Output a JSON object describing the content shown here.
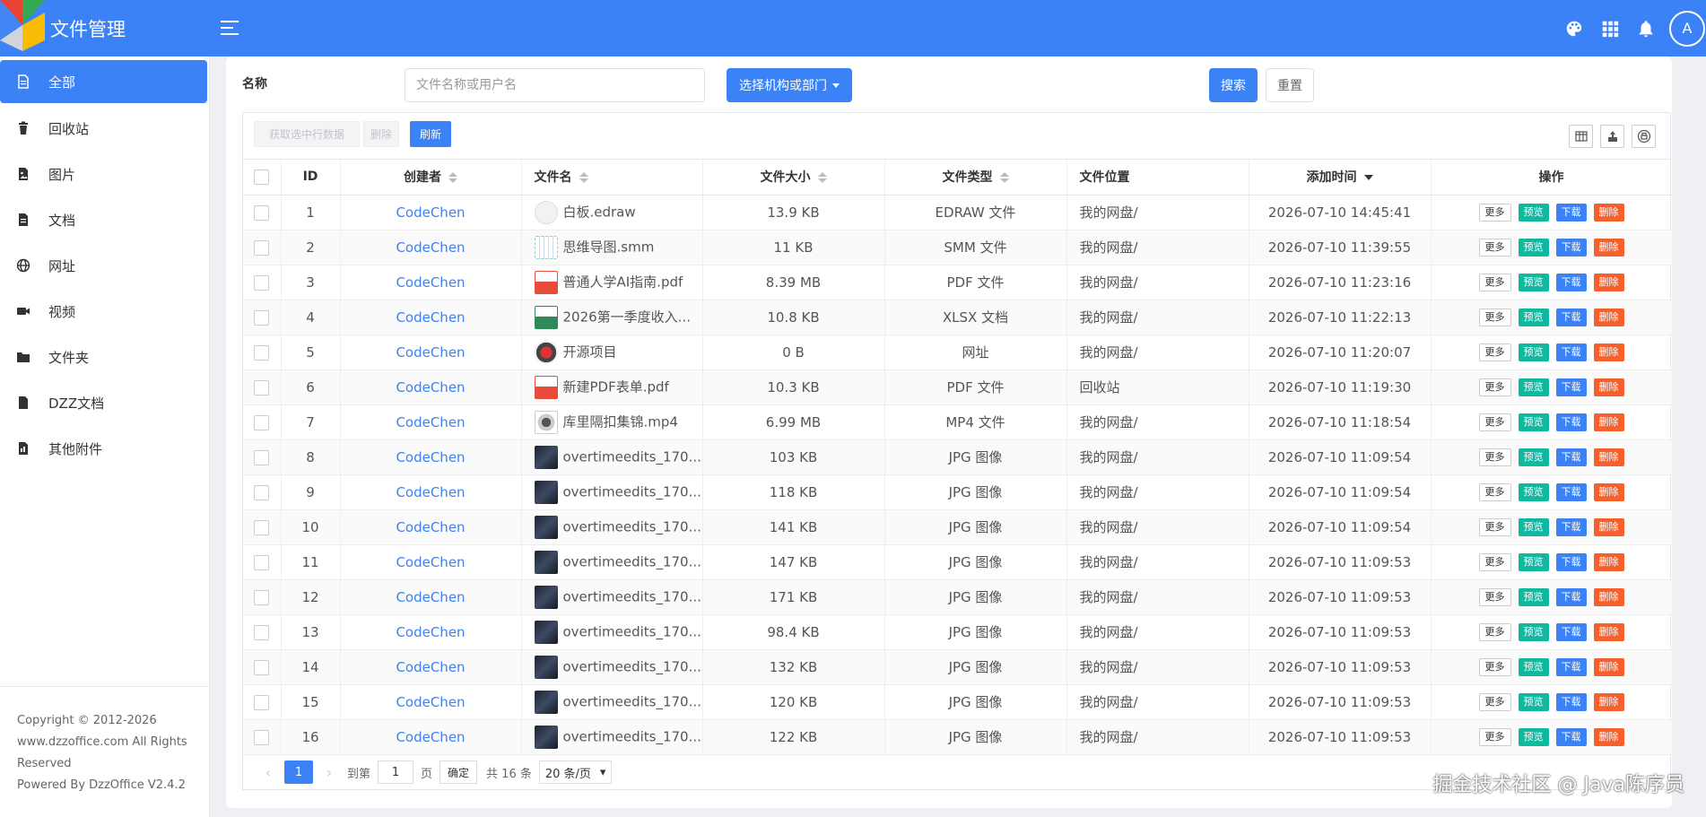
{
  "header": {
    "title": "文件管理",
    "avatar_letter": "A",
    "icons": [
      "palette-icon",
      "apps-grid-icon",
      "bell-icon"
    ],
    "accent": "#3b82f6"
  },
  "sidebar": {
    "items": [
      {
        "label": "全部",
        "icon": "file-icon",
        "active": true
      },
      {
        "label": "回收站",
        "icon": "trash-icon"
      },
      {
        "label": "图片",
        "icon": "image-icon"
      },
      {
        "label": "文档",
        "icon": "document-icon"
      },
      {
        "label": "网址",
        "icon": "globe-icon"
      },
      {
        "label": "视频",
        "icon": "video-icon"
      },
      {
        "label": "文件夹",
        "icon": "folder-icon"
      },
      {
        "label": "DZZ文档",
        "icon": "dzz-doc-icon"
      },
      {
        "label": "其他附件",
        "icon": "attachment-icon"
      }
    ],
    "footer": {
      "line1": "Copyright © 2012-2026",
      "line2": "www.dzzoffice.com All Rights",
      "line3": "Reserved",
      "line4": "Powered By DzzOffice V2.4.2"
    }
  },
  "search": {
    "label": "名称",
    "placeholder": "文件名称或用户名",
    "org_button": "选择机构或部门",
    "search_button": "搜索",
    "reset_button": "重置"
  },
  "toolbar": {
    "get_selected": "获取选中行数据",
    "delete": "删除",
    "refresh": "刷新"
  },
  "table": {
    "headers": {
      "id": "ID",
      "creator": "创建者",
      "name": "文件名",
      "size": "文件大小",
      "type": "文件类型",
      "location": "文件位置",
      "added": "添加时间",
      "ops": "操作"
    },
    "op_labels": {
      "more": "更多",
      "view": "预览",
      "download": "下载",
      "delete": "删除"
    },
    "rows": [
      {
        "id": "1",
        "creator": "CodeChen",
        "name": "白板.edraw",
        "icon": "edraw-icon",
        "size": "13.9 KB",
        "type": "EDRAW 文件",
        "location": "我的网盘/",
        "added": "2026-07-10 14:45:41"
      },
      {
        "id": "2",
        "creator": "CodeChen",
        "name": "思维导图.smm",
        "icon": "mindmap-icon",
        "size": "11 KB",
        "type": "SMM 文件",
        "location": "我的网盘/",
        "added": "2026-07-10 11:39:55"
      },
      {
        "id": "3",
        "creator": "CodeChen",
        "name": "普通人学AI指南.pdf",
        "icon": "pdf-icon",
        "size": "8.39 MB",
        "type": "PDF 文件",
        "location": "我的网盘/",
        "added": "2026-07-10 11:23:16"
      },
      {
        "id": "4",
        "creator": "CodeChen",
        "name": "2026第一季度收入...",
        "icon": "xlsx-icon",
        "size": "10.8 KB",
        "type": "XLSX 文档",
        "location": "我的网盘/",
        "added": "2026-07-10 11:22:13"
      },
      {
        "id": "5",
        "creator": "CodeChen",
        "name": "开源项目",
        "icon": "link-icon",
        "size": "0 B",
        "type": "网址",
        "location": "我的网盘/",
        "added": "2026-07-10 11:20:07"
      },
      {
        "id": "6",
        "creator": "CodeChen",
        "name": "新建PDF表单.pdf",
        "icon": "pdf-icon",
        "size": "10.3 KB",
        "type": "PDF 文件",
        "location": "回收站",
        "added": "2026-07-10 11:19:30"
      },
      {
        "id": "7",
        "creator": "CodeChen",
        "name": "库里隔扣集锦.mp4",
        "icon": "video-file-icon",
        "size": "6.99 MB",
        "type": "MP4 文件",
        "location": "我的网盘/",
        "added": "2026-07-10 11:18:54"
      },
      {
        "id": "8",
        "creator": "CodeChen",
        "name": "overtimeedits_170...",
        "icon": "jpg-thumb-icon",
        "size": "103 KB",
        "type": "JPG 图像",
        "location": "我的网盘/",
        "added": "2026-07-10 11:09:54"
      },
      {
        "id": "9",
        "creator": "CodeChen",
        "name": "overtimeedits_170...",
        "icon": "jpg-thumb-icon",
        "size": "118 KB",
        "type": "JPG 图像",
        "location": "我的网盘/",
        "added": "2026-07-10 11:09:54"
      },
      {
        "id": "10",
        "creator": "CodeChen",
        "name": "overtimeedits_170...",
        "icon": "jpg-thumb-icon",
        "size": "141 KB",
        "type": "JPG 图像",
        "location": "我的网盘/",
        "added": "2026-07-10 11:09:54"
      },
      {
        "id": "11",
        "creator": "CodeChen",
        "name": "overtimeedits_170...",
        "icon": "jpg-thumb-icon",
        "size": "147 KB",
        "type": "JPG 图像",
        "location": "我的网盘/",
        "added": "2026-07-10 11:09:53"
      },
      {
        "id": "12",
        "creator": "CodeChen",
        "name": "overtimeedits_170...",
        "icon": "jpg-thumb-icon",
        "size": "171 KB",
        "type": "JPG 图像",
        "location": "我的网盘/",
        "added": "2026-07-10 11:09:53"
      },
      {
        "id": "13",
        "creator": "CodeChen",
        "name": "overtimeedits_170...",
        "icon": "jpg-thumb-icon",
        "size": "98.4 KB",
        "type": "JPG 图像",
        "location": "我的网盘/",
        "added": "2026-07-10 11:09:53"
      },
      {
        "id": "14",
        "creator": "CodeChen",
        "name": "overtimeedits_170...",
        "icon": "jpg-thumb-icon",
        "size": "132 KB",
        "type": "JPG 图像",
        "location": "我的网盘/",
        "added": "2026-07-10 11:09:53"
      },
      {
        "id": "15",
        "creator": "CodeChen",
        "name": "overtimeedits_170...",
        "icon": "jpg-thumb-icon",
        "size": "120 KB",
        "type": "JPG 图像",
        "location": "我的网盘/",
        "added": "2026-07-10 11:09:53"
      },
      {
        "id": "16",
        "creator": "CodeChen",
        "name": "overtimeedits_170...",
        "icon": "jpg-thumb-icon",
        "size": "122 KB",
        "type": "JPG 图像",
        "location": "我的网盘/",
        "added": "2026-07-10 11:09:53"
      }
    ]
  },
  "pager": {
    "current": "1",
    "goto_label": "到第",
    "goto_value": "1",
    "page_unit": "页",
    "confirm": "确定",
    "total": "共 16 条",
    "page_size": "20 条/页"
  },
  "watermark": "掘金技术社区 @ Java陈序员"
}
